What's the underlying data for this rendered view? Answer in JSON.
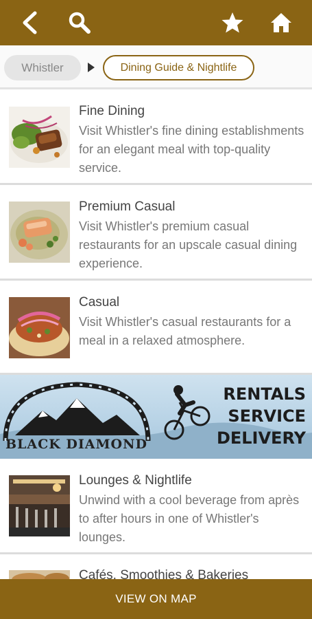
{
  "header": {
    "back_icon": "back-arrow-icon",
    "search_icon": "search-icon",
    "favorite_icon": "star-icon",
    "home_icon": "home-icon",
    "color": "#8a6414"
  },
  "breadcrumb": {
    "home_label": "Whistler",
    "current_label": "Dining Guide & Nightlife"
  },
  "categories": [
    {
      "title": "Fine Dining",
      "description": "Visit Whistler's fine dining establishments for an elegant meal with top-quality service."
    },
    {
      "title": "Premium Casual",
      "description": "Visit Whistler's premium casual restaurants for an upscale casual dining experience."
    },
    {
      "title": "Casual",
      "description": "Visit Whistler's casual restaurants for a meal in a relaxed atmosphere."
    },
    {
      "title": "Lounges & Nightlife",
      "description": "Unwind with a cool beverage from après to after hours in one of Whistler's lounges."
    },
    {
      "title": "Cafés, Smoothies & Bakeries",
      "description": ""
    }
  ],
  "ad": {
    "brand": "BLACK DIAMOND",
    "lines": [
      "RENTALS",
      "SERVICE",
      "DELIVERY"
    ]
  },
  "footer": {
    "map_button_label": "VIEW ON MAP"
  }
}
